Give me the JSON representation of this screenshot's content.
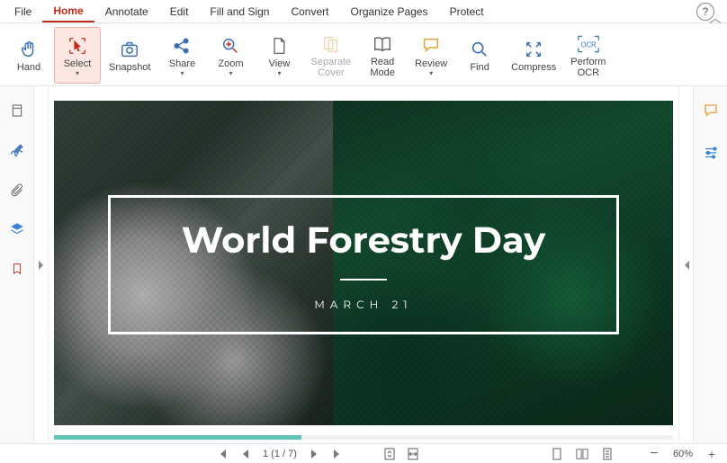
{
  "menu": {
    "items": [
      "File",
      "Home",
      "Annotate",
      "Edit",
      "Fill and Sign",
      "Convert",
      "Organize Pages",
      "Protect"
    ],
    "active_index": 1,
    "help_label": "?"
  },
  "ribbon": {
    "tools": [
      {
        "id": "hand",
        "label": "Hand",
        "dropdown": false
      },
      {
        "id": "select",
        "label": "Select",
        "dropdown": true,
        "selected": true
      },
      {
        "id": "snapshot",
        "label": "Snapshot",
        "dropdown": false
      },
      {
        "id": "share",
        "label": "Share",
        "dropdown": true
      },
      {
        "id": "zoom",
        "label": "Zoom",
        "dropdown": true
      },
      {
        "id": "view",
        "label": "View",
        "dropdown": true
      },
      {
        "id": "separate-cover",
        "label": "Separate\nCover",
        "dropdown": false,
        "disabled": true
      },
      {
        "id": "read-mode",
        "label": "Read\nMode",
        "dropdown": false
      },
      {
        "id": "review",
        "label": "Review",
        "dropdown": true
      },
      {
        "id": "find",
        "label": "Find",
        "dropdown": false
      },
      {
        "id": "compress",
        "label": "Compress",
        "dropdown": false
      },
      {
        "id": "perform-ocr",
        "label": "Perform\nOCR",
        "dropdown": false
      }
    ],
    "collapse_label": "︿"
  },
  "left_rail": {
    "items": [
      "pages-icon",
      "signature-icon",
      "attachments-icon",
      "layers-icon",
      "bookmarks-icon"
    ]
  },
  "right_rail": {
    "items": [
      "comment-icon",
      "properties-icon"
    ]
  },
  "document": {
    "title": "World Forestry Day",
    "subtitle": "MARCH 21"
  },
  "statusbar": {
    "first_label": "⏮",
    "prev_label": "◀",
    "page_indicator": "1 (1 / 7)",
    "next_label": "▶",
    "last_label": "⏭",
    "zoom_out": "−",
    "zoom_level": "60%",
    "zoom_in": "+"
  }
}
